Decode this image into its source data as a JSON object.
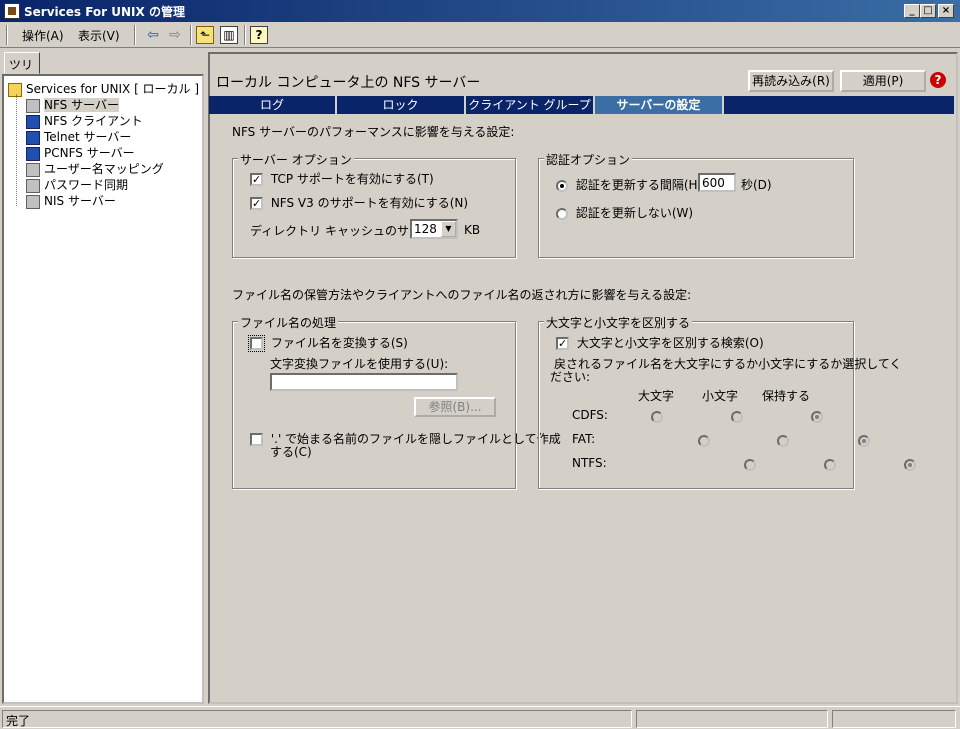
{
  "window": {
    "title": "Services For UNIX の管理",
    "min_glyph": "_",
    "max_glyph": "□",
    "close_glyph": "×"
  },
  "toolbar": {
    "menu_action": "操作(A)",
    "menu_view": "表示(V)",
    "back_glyph": "⇦",
    "forward_glyph": "⇨",
    "up_glyph": "⬑",
    "showhide_glyph": "▥",
    "help_glyph": "?"
  },
  "tree": {
    "tab_label": "ツリー",
    "root": "Services for UNIX [ ローカル ]",
    "items": [
      {
        "label": "NFS サーバー",
        "icon": "server-icon",
        "selected": true
      },
      {
        "label": "NFS クライアント",
        "icon": "client-icon",
        "selected": false
      },
      {
        "label": "Telnet サーバー",
        "icon": "telnet-icon",
        "selected": false
      },
      {
        "label": "PCNFS サーバー",
        "icon": "pcnfs-icon",
        "selected": false
      },
      {
        "label": "ユーザー名マッピング",
        "icon": "mapping-icon",
        "selected": false
      },
      {
        "label": "パスワード同期",
        "icon": "password-sync-icon",
        "selected": false
      },
      {
        "label": "NIS サーバー",
        "icon": "nis-icon",
        "selected": false
      }
    ]
  },
  "main": {
    "heading": "ローカル コンピュータ上の NFS サーバー",
    "reload_button": "再読み込み(R)",
    "apply_button": "適用(P)",
    "help_glyph": "?",
    "tabs": [
      "ログ",
      "ロック",
      "クライアント グループ",
      "サーバーの設定"
    ],
    "active_tab": 3,
    "perf_intro": "NFS サーバーのパフォーマンスに影響を与える設定:",
    "server_options": {
      "legend": "サーバー オプション",
      "tcp_label": "TCP サポートを有効にする(T)",
      "tcp_checked": true,
      "v3_label": "NFS V3 のサポートを有効にする(N)",
      "v3_checked": true,
      "cache_label": "ディレクトリ キャッシュのサイズ(I):",
      "cache_value": "128",
      "cache_unit": "KB"
    },
    "auth_options": {
      "legend": "認証オプション",
      "refresh_label": "認証を更新する間隔(H):",
      "refresh_value": "600",
      "refresh_unit": "秒(D)",
      "refresh_selected": true,
      "no_refresh_label": "認証を更新しない(W)"
    },
    "filename_intro": "ファイル名の保管方法やクライアントへのファイル名の返され方に影響を与える設定:",
    "filename_handling": {
      "legend": "ファイル名の処理",
      "convert_label": "ファイル名を変換する(S)",
      "convert_checked": false,
      "mapfile_label": "文字変換ファイルを使用する(U):",
      "mapfile_value": "",
      "browse_button": "参照(B)...",
      "hidden_label_1": "'.' で始まる名前のファイルを隠しファイルとして作成",
      "hidden_label_2": "する(C)",
      "hidden_checked": false
    },
    "case_sensitivity": {
      "legend": "大文字と小文字を区別する",
      "search_label": "大文字と小文字を区別する検索(O)",
      "search_checked": true,
      "desc_1": "戻されるファイル名を大文字にするか小文字にするか選択してく",
      "desc_2": "ださい:",
      "col_upper": "大文字",
      "col_lower": "小文字",
      "col_keep": "保持する",
      "rows": [
        {
          "name": "CDFS:",
          "selected": "保持する"
        },
        {
          "name": "FAT:",
          "selected": "保持する"
        },
        {
          "name": "NTFS:",
          "selected": "保持する"
        }
      ]
    }
  },
  "status": {
    "text": "完了"
  }
}
